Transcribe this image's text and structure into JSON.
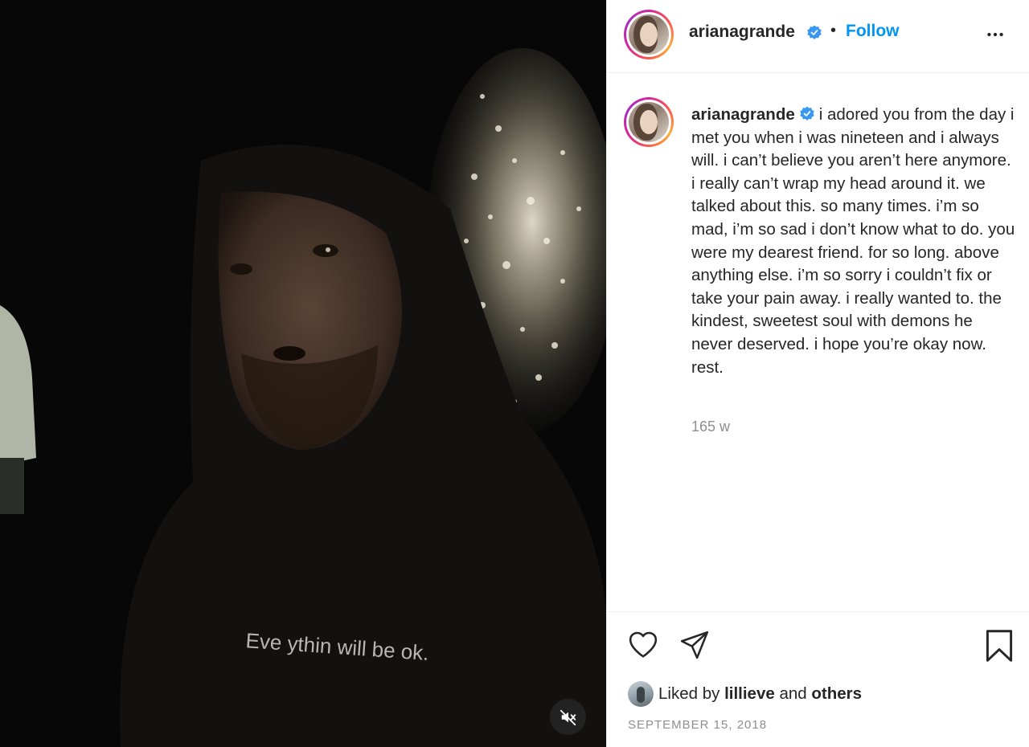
{
  "post": {
    "header": {
      "username": "arianagrande",
      "separator": "•",
      "follow_label": "Follow",
      "more_icon": "more-horizontal-icon"
    },
    "caption": {
      "username": "arianagrande",
      "text": "i adored you from the day i met you when i was nineteen and i always will. i can’t believe you aren’t here anymore. i really can’t wrap my head around it. we talked about this. so many times. i’m so mad, i’m so sad i don’t know what to do. you were my dearest friend. for so long. above anything else. i’m so sorry i couldn’t fix or take your pain away. i really wanted to. the kindest, sweetest soul with demons he never deserved. i hope you’re okay now. rest.",
      "time_ago": "165 w"
    },
    "actions": {
      "icons": [
        "heart-icon",
        "share-icon",
        "bookmark-icon"
      ]
    },
    "likes": {
      "prefix": "Liked by",
      "user": "lillieve",
      "conjunction": "and",
      "others": "others"
    },
    "date": "SEPTEMBER 15, 2018",
    "media": {
      "shirt_text": "Eve ythin will be ok.",
      "mute_icon": "muted-speaker-icon"
    }
  },
  "colors": {
    "link_blue": "#0095f6",
    "verified_blue": "#3897f0",
    "text_primary": "#262626",
    "text_secondary": "#8e8e8e",
    "media_bg": "#070707"
  }
}
